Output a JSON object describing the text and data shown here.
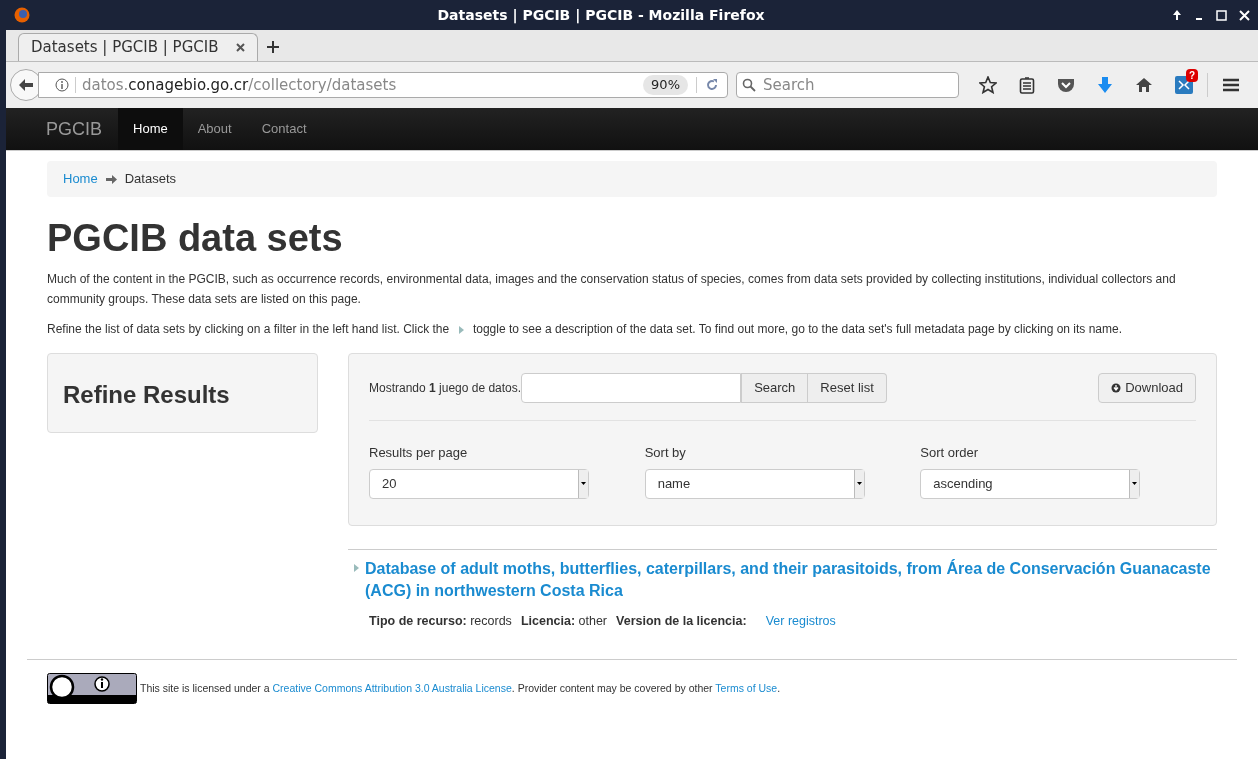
{
  "window": {
    "title": "Datasets | PGCIB | PGCIB - Mozilla Firefox"
  },
  "tabs": [
    {
      "label": "Datasets | PGCIB | PGCIB",
      "selected": true
    }
  ],
  "address_bar": {
    "prefix": "datos.",
    "domain": "conagebio.go.cr",
    "path": "/collectory/datasets",
    "zoom": "90%"
  },
  "search": {
    "placeholder": "Search"
  },
  "toolbar": {
    "badge": "?"
  },
  "navbar": {
    "brand": "PGCIB",
    "items": [
      {
        "label": "Home",
        "selected": true
      },
      {
        "label": "About",
        "selected": false
      },
      {
        "label": "Contact",
        "selected": false
      }
    ]
  },
  "breadcrumb": [
    {
      "label": "Home",
      "link": true
    },
    {
      "label": "Datasets",
      "link": false
    }
  ],
  "heading": "PGCIB data sets",
  "intro": "Much of the content in the PGCIB, such as occurrence records, environmental data, images and the conservation status of species, comes from data sets provided by collecting institutions, individual collectors and community groups. These data sets are listed on this page.",
  "instructions": {
    "before": "Refine the list of data sets by clicking on a filter in the left hand list. Click the",
    "after": "toggle to see a description of the data set. To find out more, go to the data set's full metadata page by clicking on its name."
  },
  "sidebar": {
    "title": "Refine Results"
  },
  "panel": {
    "count": "Mostrando **1** juego de datos.",
    "search_button": "Search",
    "reset_button": "Reset list",
    "download_button": "Download",
    "selects": [
      {
        "label": "Results per page",
        "value": "20"
      },
      {
        "label": "Sort by",
        "value": "name"
      },
      {
        "label": "Sort order",
        "value": "ascending"
      }
    ]
  },
  "results": [
    {
      "title": "Database of adult moths, butterflies, caterpillars, and their parasitoids, from Área de Conservación Guanacaste (ACG) in northwestern Costa Rica",
      "meta": [
        "**Tipo de recurso:** records",
        "**Licencia:** other",
        "**Version de la licencia:**"
      ],
      "link": "Ver registros"
    }
  ],
  "footer": {
    "before": "This site is licensed under a",
    "license_link": "Creative Commons Attribution 3.0 Australia License",
    "middle": ". Provider content may be covered by other",
    "terms_link": "Terms of Use",
    "after": "."
  }
}
